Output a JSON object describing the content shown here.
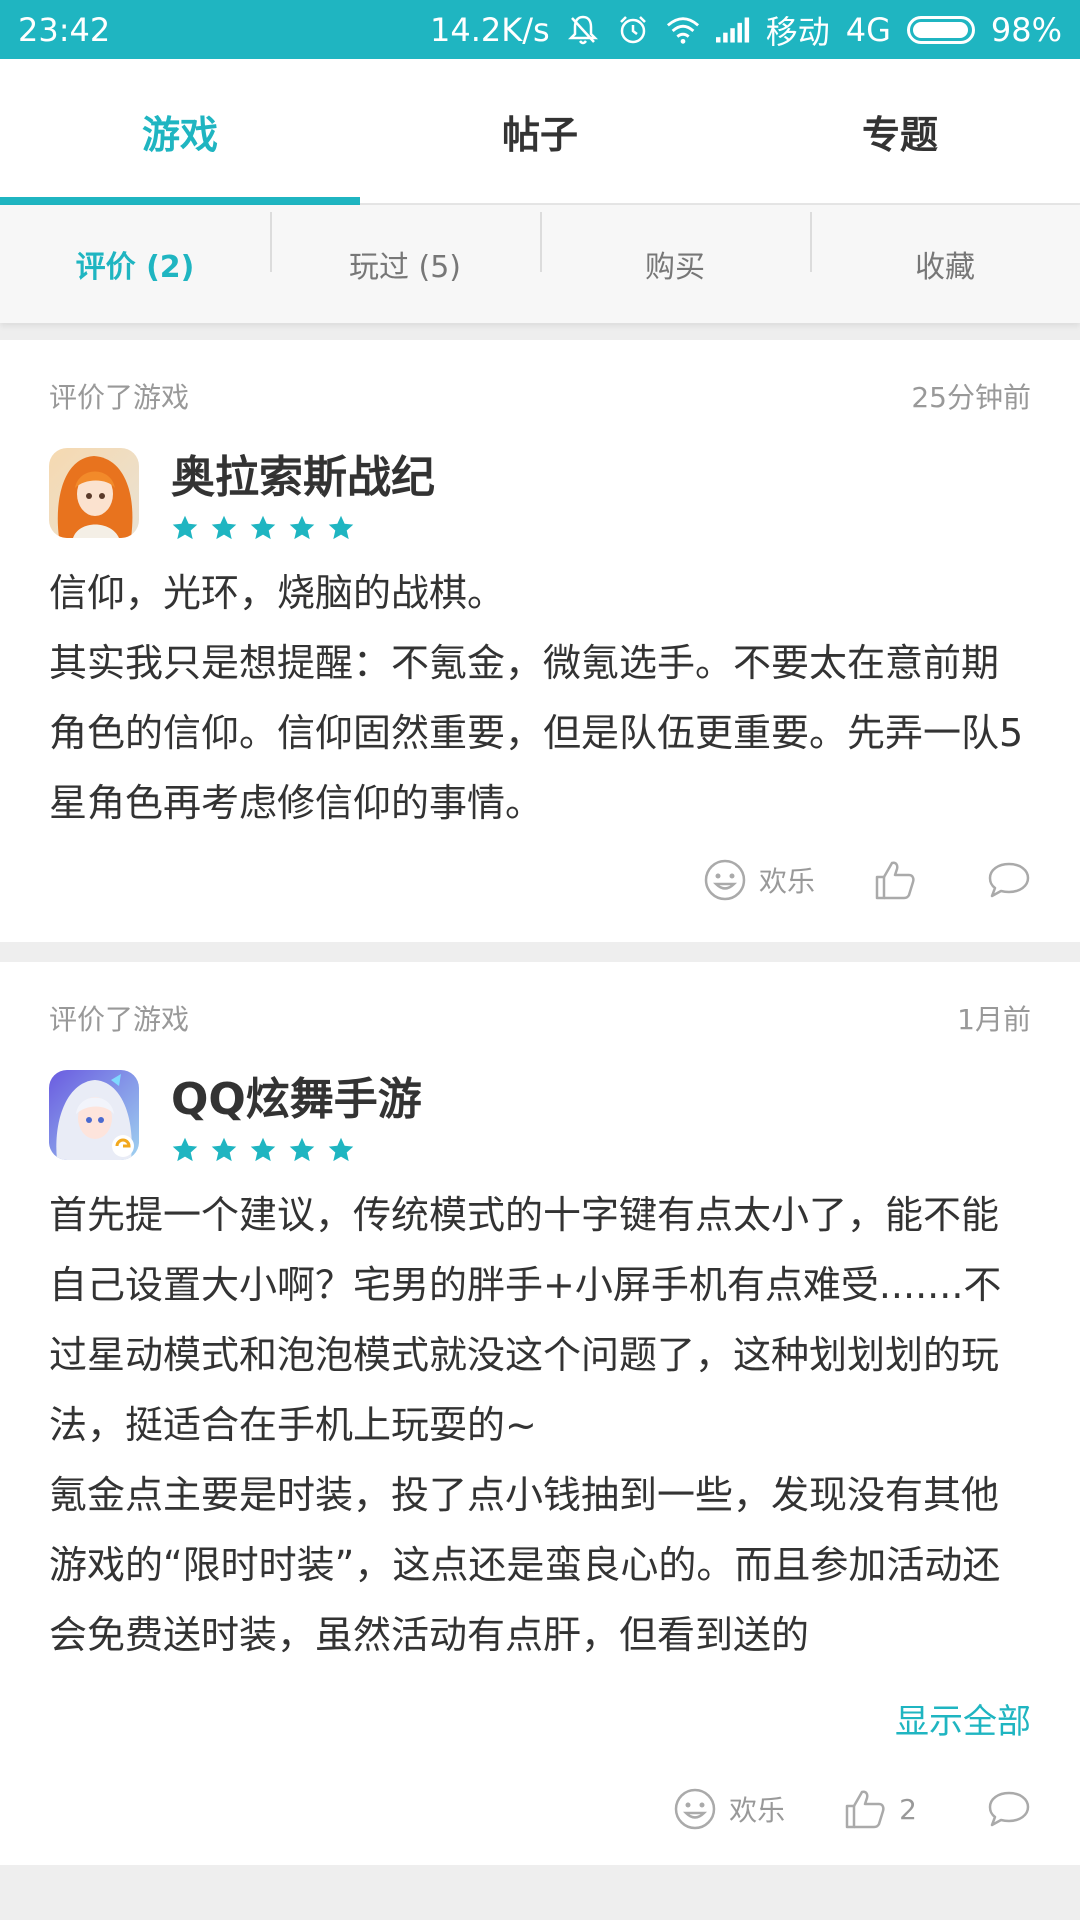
{
  "status_bar": {
    "time": "23:42",
    "net_speed": "14.2K/s",
    "carrier": "移动",
    "network": "4G",
    "battery": "98%"
  },
  "top_tabs": [
    {
      "label": "游戏",
      "active": true
    },
    {
      "label": "帖子",
      "active": false
    },
    {
      "label": "专题",
      "active": false
    }
  ],
  "sub_tabs": [
    {
      "label": "评价 (2)",
      "active": true
    },
    {
      "label": "玩过 (5)",
      "active": false
    },
    {
      "label": "购买",
      "active": false
    },
    {
      "label": "收藏",
      "active": false
    }
  ],
  "reviews": [
    {
      "action_text": "评价了游戏",
      "time": "25分钟前",
      "game_name": "奥拉索斯战纪",
      "rating": 5,
      "body": "信仰，光环，烧脑的战棋。\n其实我只是想提醒：不氪金，微氪选手。不要太在意前期角色的信仰。信仰固然重要，但是队伍更重要。先弄一队5星角色再考虑修信仰的事情。",
      "mood": "欢乐",
      "likes": ""
    },
    {
      "action_text": "评价了游戏",
      "time": "1月前",
      "game_name": "QQ炫舞手游",
      "rating": 5,
      "body": "首先提一个建议，传统模式的十字键有点太小了，能不能自己设置大小啊？宅男的胖手+小屏手机有点难受.......不过星动模式和泡泡模式就没这个问题了，这种划划划的玩法，挺适合在手机上玩耍的~\n氪金点主要是时装，投了点小钱抽到一些，发现没有其他游戏的“限时时装”，这点还是蛮良心的。而且参加活动还会免费送时装，虽然活动有点肝，但看到送的",
      "show_all": "显示全部",
      "mood": "欢乐",
      "likes": "2"
    }
  ],
  "colors": {
    "accent": "#1fb5c1"
  }
}
